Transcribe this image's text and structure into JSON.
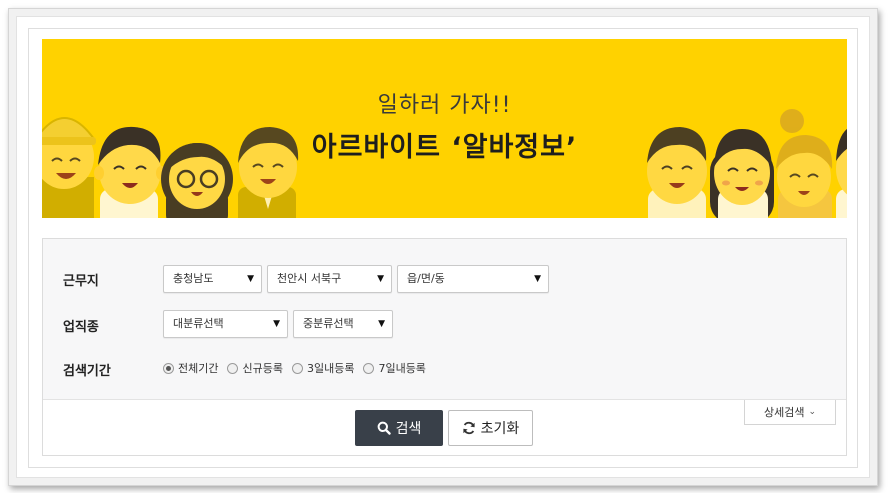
{
  "banner": {
    "subtitle": "일하러 가자!!",
    "title": "아르바이트 ‘알바정보’",
    "colors": {
      "background": "#ffd200",
      "character_skin": "#ffd94a",
      "hair": "#3a3126"
    }
  },
  "search": {
    "location": {
      "label": "근무지",
      "province": "충청남도",
      "city": "천안시 서북구",
      "town": "읍/면/동"
    },
    "job": {
      "label": "업직종",
      "major": "대분류선택",
      "minor": "중분류선택"
    },
    "period": {
      "label": "검색기간",
      "options": [
        "전체기간",
        "신규등록",
        "3일내등록",
        "7일내등록"
      ],
      "selected": "전체기간"
    },
    "buttons": {
      "search": "검색",
      "reset": "초기화",
      "detail": "상세검색"
    },
    "colors": {
      "search_button": "#394049",
      "panel": "#f7f7f8"
    }
  }
}
